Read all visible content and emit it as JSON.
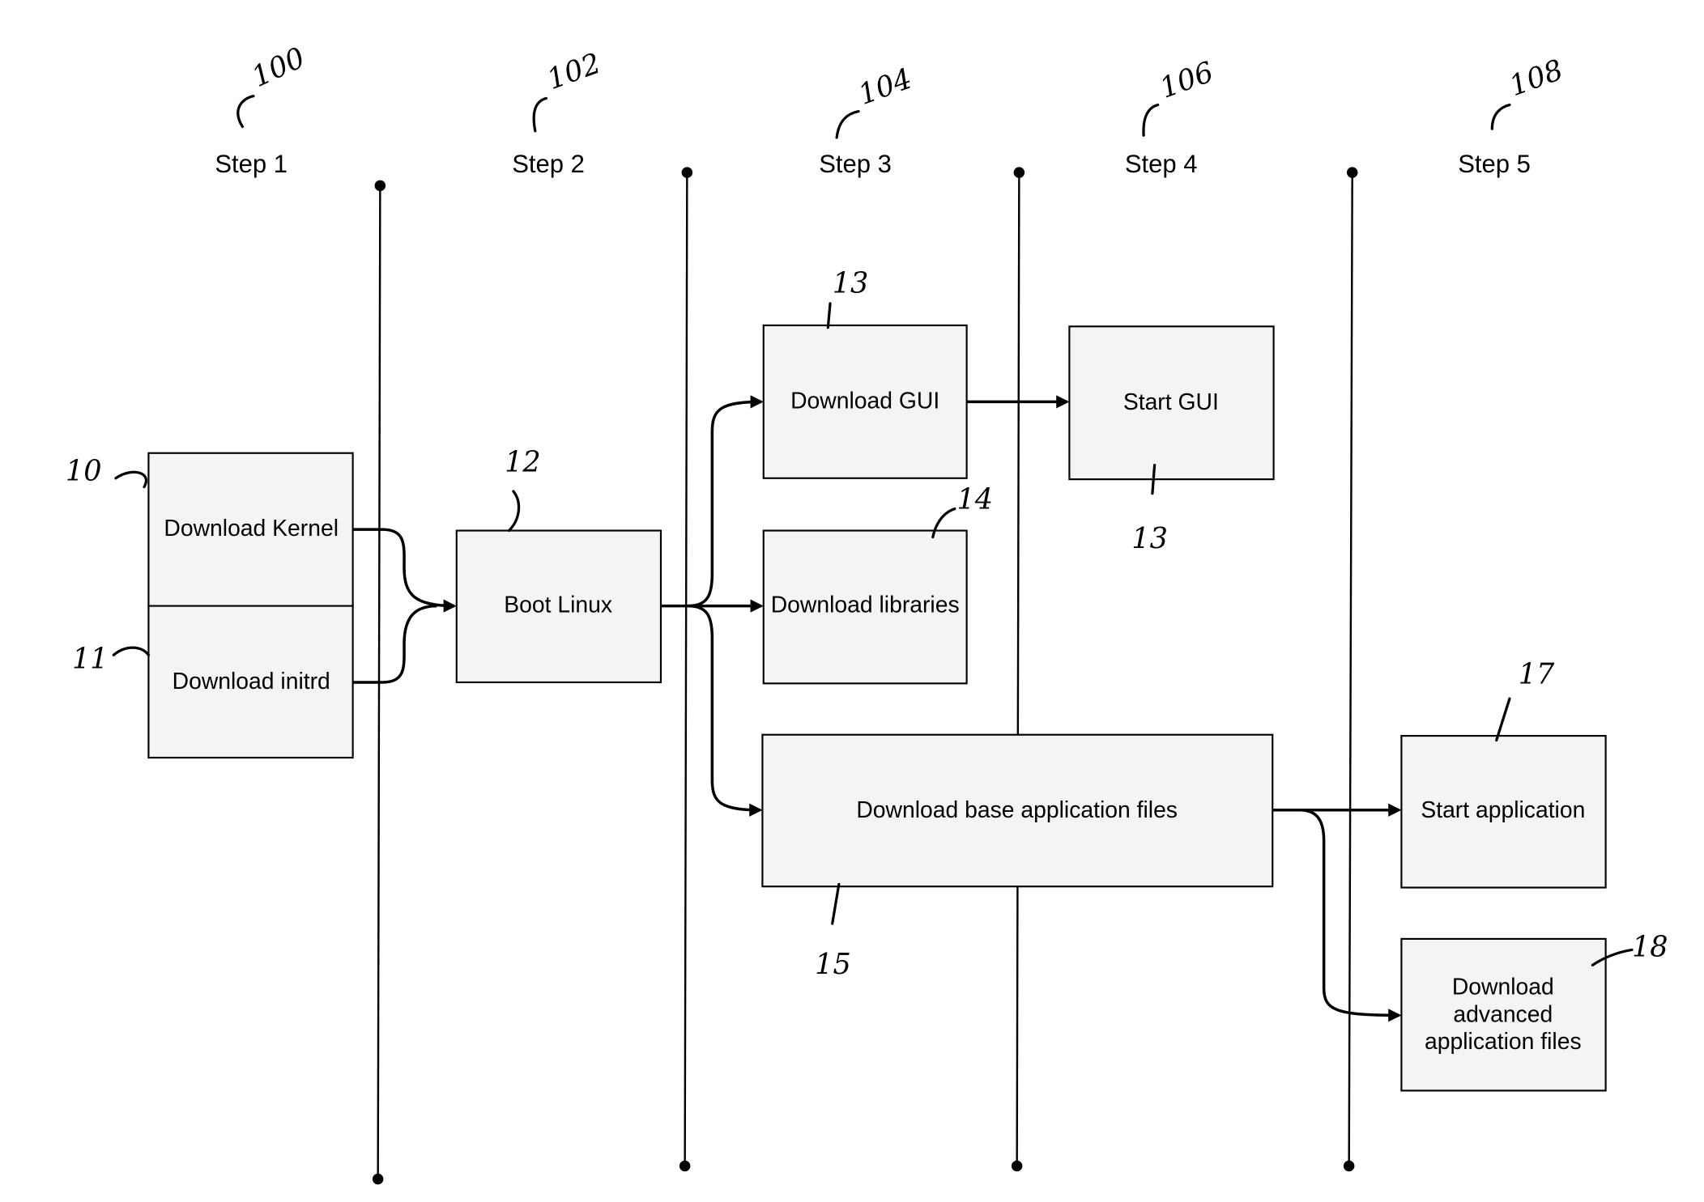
{
  "steps": [
    {
      "label": "Step 1",
      "ref": "100"
    },
    {
      "label": "Step 2",
      "ref": "102"
    },
    {
      "label": "Step 3",
      "ref": "104"
    },
    {
      "label": "Step 4",
      "ref": "106"
    },
    {
      "label": "Step 5",
      "ref": "108"
    }
  ],
  "boxes": {
    "download_kernel": {
      "label": "Download Kernel",
      "ref": "10"
    },
    "download_initrd": {
      "label": "Download initrd",
      "ref": "11"
    },
    "boot_linux": {
      "label": "Boot Linux",
      "ref": "12"
    },
    "download_gui": {
      "label": "Download GUI",
      "ref": "13"
    },
    "start_gui": {
      "label": "Start GUI",
      "ref": "13"
    },
    "download_libraries": {
      "label": "Download libraries",
      "ref": "14"
    },
    "download_base_app": {
      "label": "Download base application files",
      "ref": "15"
    },
    "start_application": {
      "label": "Start application",
      "ref": "17"
    },
    "download_advanced": {
      "label_lines": [
        "Download",
        "advanced",
        "application files"
      ],
      "ref": "18"
    }
  }
}
